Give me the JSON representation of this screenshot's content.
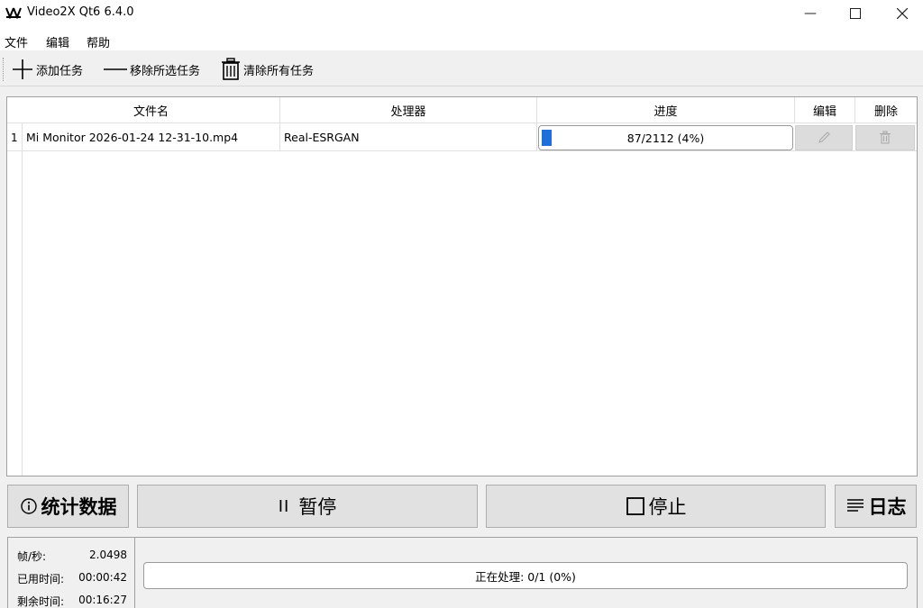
{
  "window": {
    "title": "Video2X Qt6 6.4.0",
    "minimize_glyph": "—",
    "maximize_glyph": "☐",
    "close_glyph": "✕"
  },
  "menu": {
    "file": "文件",
    "edit": "编辑",
    "help": "帮助"
  },
  "toolbar": {
    "add_task": "添加任务",
    "remove_selected": "移除所选任务",
    "clear_all": "清除所有任务"
  },
  "table": {
    "headers": {
      "filename": "文件名",
      "processor": "处理器",
      "progress": "进度",
      "edit": "编辑",
      "delete": "删除"
    },
    "rows": [
      {
        "index": "1",
        "filename": "Mi Monitor 2026-01-24 12-31-10.mp4",
        "processor": "Real-ESRGAN",
        "progress_text": "87/2112 (4%)",
        "progress_fraction": 0.04
      }
    ]
  },
  "buttons": {
    "stats": "统计数据",
    "pause_glyph": "II",
    "pause": "暂停",
    "stop": "停止",
    "log": "日志"
  },
  "stats": {
    "fps_label": "帧/秒:",
    "fps_value": "2.0498",
    "elapsed_label": "已用时间:",
    "elapsed_value": "00:00:42",
    "remaining_label": "剩余时间:",
    "remaining_value": "00:16:27"
  },
  "status": {
    "overall_progress": "正在处理: 0/1 (0%)",
    "overall_fraction": 0.0
  },
  "colors": {
    "progress_fill": "#1e6fd9"
  }
}
